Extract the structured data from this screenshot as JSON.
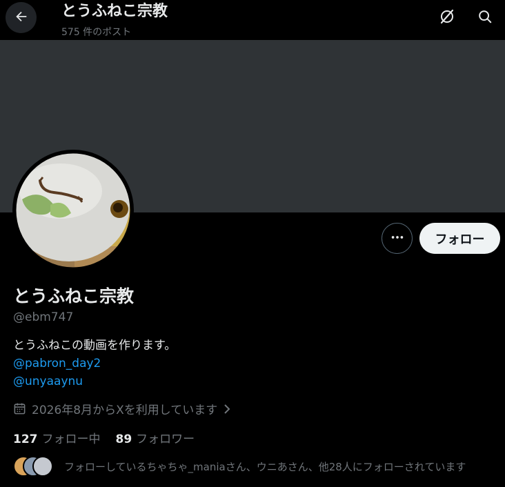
{
  "header": {
    "title": "とうふねこ宗教",
    "post_count": "575 件のポスト",
    "back_icon": "arrow-left-icon",
    "grok_icon": "grok-icon",
    "search_icon": "search-icon"
  },
  "profile": {
    "name": "とうふねこ宗教",
    "handle": "@ebm747",
    "bio_text": "とうふねこの動画を作ります。",
    "bio_links": [
      "@pabron_day2",
      "@unyaaynu"
    ],
    "joined": "2026年8月からXを利用しています",
    "following_count": "127",
    "following_label": "フォロー中",
    "followers_count": "89",
    "followers_label": "フォロワー",
    "known_followers": "フォローしているちゃちゃ_maniaさん、ウニあさん、他28人にフォローされています"
  },
  "actions": {
    "follow_label": "フォロー",
    "more_icon": "more-horizontal-icon"
  },
  "colors": {
    "background": "#000000",
    "banner": "#2f3336",
    "link": "#1d9bf0",
    "secondary_text": "#71767b",
    "follow_button_bg": "#eff3f4"
  }
}
